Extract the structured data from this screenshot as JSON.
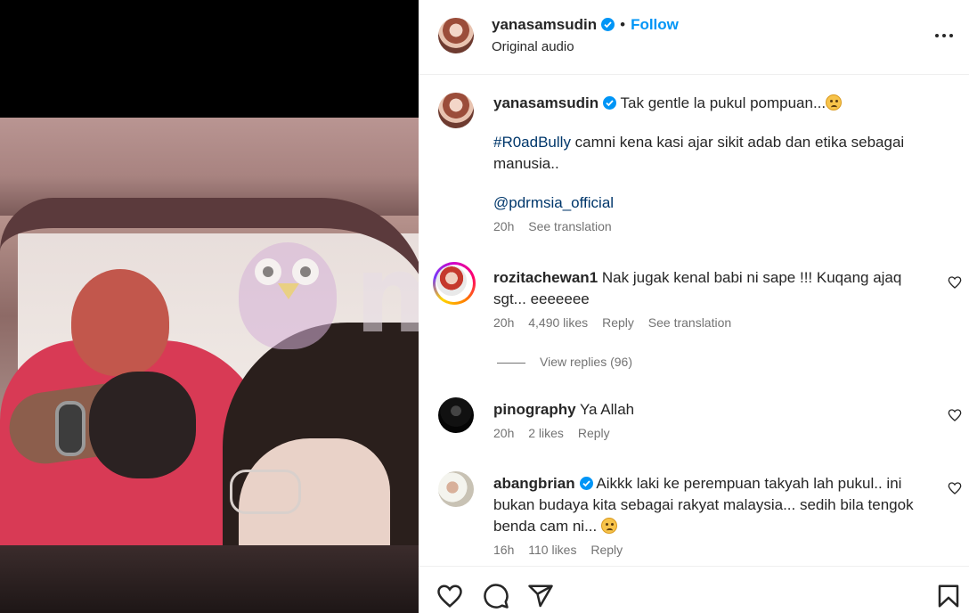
{
  "media": {
    "watermark_text": "murai"
  },
  "header": {
    "username": "yanasamsudin",
    "dot": "•",
    "follow_label": "Follow",
    "subtitle": "Original audio"
  },
  "caption": {
    "username": "yanasamsudin",
    "line1": "Tak gentle la pukul pompuan...",
    "hashtag": "#R0adBully",
    "line2_rest": " camni kena kasi ajar sikit adab dan etika sebagai",
    "line3": "manusia..",
    "mention": "@pdrmsia_official",
    "time": "20h",
    "see_translation": "See translation"
  },
  "comments": [
    {
      "username": "rozitachewan1",
      "text_line1": "Nak jugak kenal babi ni sape !!! Kuqang ajaq",
      "text_line2": "sgt... eeeeeee",
      "time": "20h",
      "likes": "4,490 likes",
      "reply": "Reply",
      "see_translation": "See translation",
      "view_replies": "View replies (96)"
    },
    {
      "username": "pinography",
      "text": "Ya Allah",
      "time": "20h",
      "likes": "2 likes",
      "reply": "Reply"
    },
    {
      "username": "abangbrian",
      "text_line1": "Aikkk laki ke perempuan takyah lah pukul.. ini",
      "text_line2": "bukan budaya kita sebagai rakyat malaysia... sedih bila tengok",
      "text_line3": "benda cam ni...",
      "time": "16h",
      "likes": "110 likes",
      "reply": "Reply"
    }
  ],
  "icons": {
    "like": "heart-icon",
    "comment": "comment-icon",
    "share": "share-icon",
    "save": "bookmark-icon",
    "more": "more-options-icon",
    "verified": "verified-badge-icon"
  },
  "colors": {
    "link_blue": "#0095f6",
    "hashtag_blue": "#00376b",
    "muted": "#737373",
    "text": "#262626",
    "verified": "#0095f6"
  }
}
